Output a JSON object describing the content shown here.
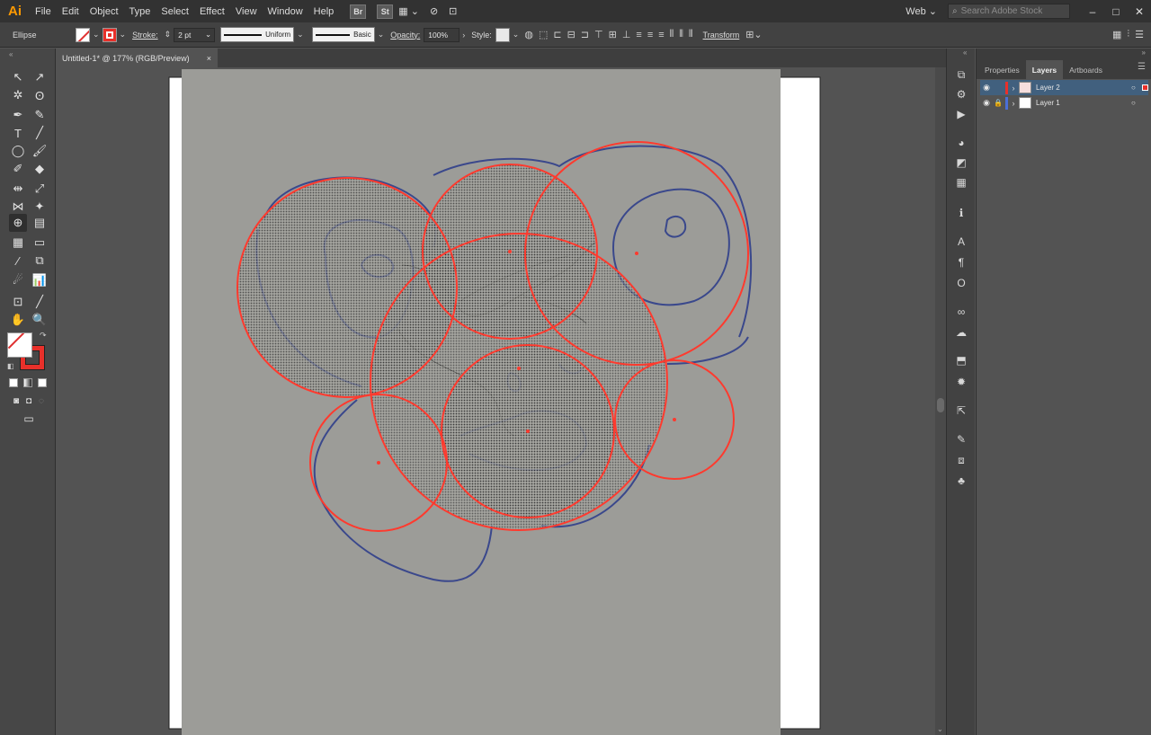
{
  "app": {
    "logo": "Ai",
    "menus": [
      "File",
      "Edit",
      "Object",
      "Type",
      "Select",
      "Effect",
      "View",
      "Window",
      "Help"
    ],
    "bridge_buttons": [
      "Br",
      "St"
    ],
    "workspace": "Web",
    "search_placeholder": "Search Adobe Stock"
  },
  "control_bar": {
    "object_type": "Ellipse",
    "stroke_label": "Stroke:",
    "stroke_weight": "2 pt",
    "variable_width_profile": "Uniform",
    "brush_definition": "Basic",
    "opacity_label": "Opacity:",
    "opacity_value": "100%",
    "style_label": "Style:",
    "transform_label": "Transform",
    "stroke_color": "#e8302a",
    "fill": "none"
  },
  "document": {
    "tab_title": "Untitled-1* @ 177% (RGB/Preview)",
    "close_glyph": "×"
  },
  "layers_panel": {
    "tabs": [
      "Properties",
      "Layers",
      "Artboards"
    ],
    "active_tab": "Layers",
    "layers": [
      {
        "name": "Layer 2",
        "color": "#e8302a",
        "selected": true,
        "locked": false
      },
      {
        "name": "Layer 1",
        "color": "#4a6fd8",
        "selected": false,
        "locked": true
      }
    ]
  },
  "artwork": {
    "circle_stroke_color": "#ff3a2e",
    "sketch_ink_color": "#2a3a8a"
  }
}
